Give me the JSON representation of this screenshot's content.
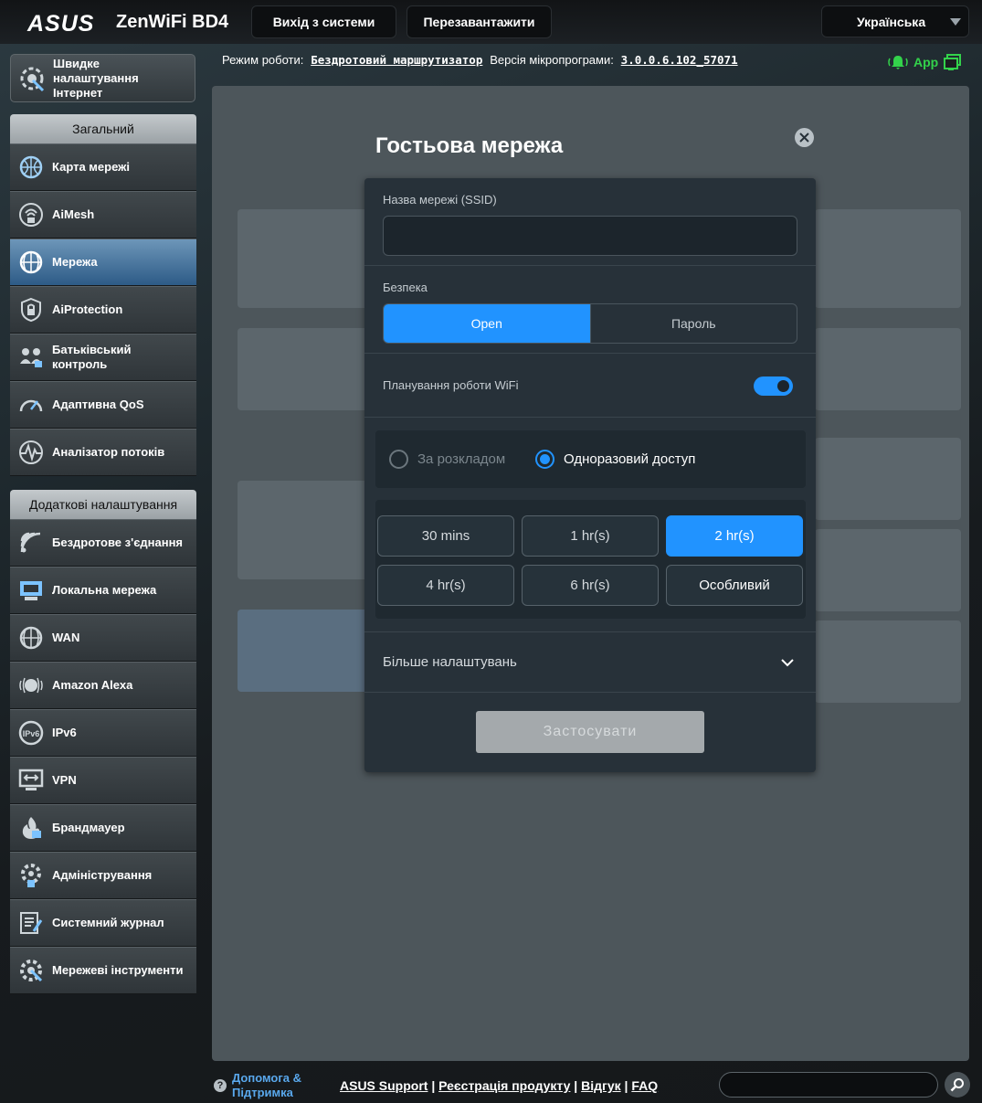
{
  "header": {
    "brand": "ASUS",
    "model": "ZenWiFi BD4",
    "logout_label": "Вихід з системи",
    "reboot_label": "Перезавантажити",
    "language": "Українська"
  },
  "status": {
    "mode_label": "Режим роботи:",
    "mode_value": "Бездротовий маршрутизатор",
    "fw_label": "Версія мікропрограми:",
    "fw_value": "3.0.0.6.102_57071",
    "app_label": "App"
  },
  "sidebar": {
    "quick_setup": "Швидке налаштування Інтернет",
    "general_header": "Загальний",
    "general_items": [
      {
        "label": "Карта мережі",
        "icon": "network-map-icon"
      },
      {
        "label": "AiMesh",
        "icon": "aimesh-icon"
      },
      {
        "label": "Мережа",
        "icon": "globe-network-icon"
      },
      {
        "label": "AiProtection",
        "icon": "shield-lock-icon"
      },
      {
        "label": "Батьківський контроль",
        "icon": "parental-control-icon"
      },
      {
        "label": "Адаптивна QoS",
        "icon": "gauge-icon"
      },
      {
        "label": "Аналізатор потоків",
        "icon": "traffic-analyzer-icon"
      }
    ],
    "advanced_header": "Додаткові налаштування",
    "advanced_items": [
      {
        "label": "Бездротове з'єднання",
        "icon": "wireless-icon"
      },
      {
        "label": "Локальна мережа",
        "icon": "lan-icon"
      },
      {
        "label": "WAN",
        "icon": "wan-globe-icon"
      },
      {
        "label": "Amazon Alexa",
        "icon": "alexa-icon"
      },
      {
        "label": "IPv6",
        "icon": "ipv6-icon"
      },
      {
        "label": "VPN",
        "icon": "vpn-icon"
      },
      {
        "label": "Брандмауер",
        "icon": "firewall-icon"
      },
      {
        "label": "Адміністрування",
        "icon": "admin-gear-icon"
      },
      {
        "label": "Системний журнал",
        "icon": "system-log-icon"
      },
      {
        "label": "Мережеві інструменти",
        "icon": "network-tools-icon"
      }
    ],
    "active_item": "Мережа"
  },
  "modal": {
    "title": "Гостьова мережа",
    "ssid_label": "Назва мережі (SSID)",
    "ssid_value": "",
    "security_label": "Безпека",
    "security_options": [
      "Open",
      "Пароль"
    ],
    "security_selected": "Open",
    "schedule_label": "Планування роботи WiFi",
    "schedule_enabled": true,
    "schedule_modes": [
      "За розкладом",
      "Одноразовий доступ"
    ],
    "schedule_mode_selected": "Одноразовий доступ",
    "durations": [
      "30 mins",
      "1 hr(s)",
      "2 hr(s)",
      "4 hr(s)",
      "6 hr(s)",
      "Особливий"
    ],
    "duration_selected": "2 hr(s)",
    "more_settings": "Більше налаштувань",
    "apply_label": "Застосувати"
  },
  "footer": {
    "help_label": "Допомога & Підтримка",
    "links": [
      "ASUS Support",
      "Реєстрація продукту",
      "Відгук",
      "FAQ"
    ],
    "search_value": ""
  },
  "colors": {
    "accent": "#2193ff",
    "app_indicator": "#33d24b",
    "help_link": "#59a8ec"
  }
}
